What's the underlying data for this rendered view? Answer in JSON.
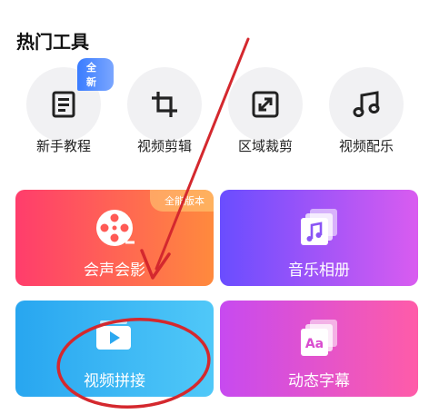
{
  "section_title": "热门工具",
  "tools": [
    {
      "label": "新手教程",
      "icon": "tutorial-icon",
      "badge": "全新"
    },
    {
      "label": "视频剪辑",
      "icon": "crop-icon"
    },
    {
      "label": "区域裁剪",
      "icon": "expand-icon"
    },
    {
      "label": "视频配乐",
      "icon": "music-note-icon"
    }
  ],
  "cards": [
    {
      "label": "会声会影",
      "icon": "film-reel-icon",
      "corner_badge": "全能版本"
    },
    {
      "label": "音乐相册",
      "icon": "music-album-icon"
    },
    {
      "label": "视频拼接",
      "icon": "video-join-icon"
    },
    {
      "label": "动态字幕",
      "icon": "subtitle-icon",
      "icon_text": "Aa"
    }
  ],
  "colors": {
    "annotation_red": "#d4282e",
    "tool_circle_bg": "#f1f1f3"
  }
}
